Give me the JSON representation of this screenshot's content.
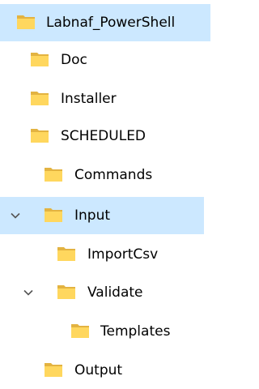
{
  "tree": {
    "items": [
      {
        "label": "Labnaf_PowerShell",
        "icon": "folder-icon",
        "selected": true
      },
      {
        "label": "Doc",
        "icon": "folder-icon"
      },
      {
        "label": "Installer",
        "icon": "folder-icon"
      },
      {
        "label": "SCHEDULED",
        "icon": "folder-icon"
      },
      {
        "label": "Commands",
        "icon": "folder-icon"
      },
      {
        "label": "Input",
        "icon": "folder-icon",
        "expanded": true,
        "hovered": true
      },
      {
        "label": "ImportCsv",
        "icon": "folder-icon"
      },
      {
        "label": "Validate",
        "icon": "folder-icon",
        "expanded": true
      },
      {
        "label": "Templates",
        "icon": "folder-icon"
      },
      {
        "label": "Output",
        "icon": "folder-icon"
      }
    ]
  },
  "colors": {
    "highlight": "#cce8ff",
    "folder_back": "#e3b341",
    "folder_front": "#ffd75e",
    "chevron": "#555555"
  }
}
